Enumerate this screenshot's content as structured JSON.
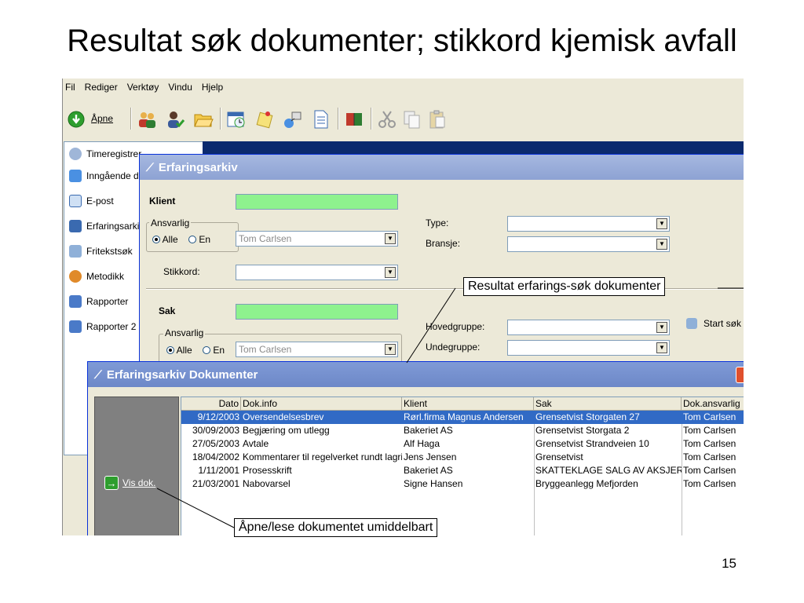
{
  "slide": {
    "title": "Resultat søk dokumenter; stikkord kjemisk avfall",
    "page_number": "15"
  },
  "menu": [
    "Fil",
    "Rediger",
    "Verktøy",
    "Vindu",
    "Hjelp"
  ],
  "toolbar": {
    "open_label": "Åpne"
  },
  "sidebar": {
    "items": [
      {
        "label": "Timeregistrer",
        "icon": "clock-icon"
      },
      {
        "label": "Inngående d",
        "icon": "inbox-icon"
      },
      {
        "label": "E-post",
        "icon": "email-icon"
      },
      {
        "label": "Erfaringsarki",
        "icon": "archive-icon"
      },
      {
        "label": "Fritekstsøk",
        "icon": "search-icon"
      },
      {
        "label": "Metodikk",
        "icon": "method-icon"
      },
      {
        "label": "Rapporter",
        "icon": "report-icon"
      },
      {
        "label": "Rapporter 2",
        "icon": "report-icon"
      }
    ]
  },
  "search_window": {
    "title": "Erfaringsarkiv",
    "klient": {
      "heading": "Klient",
      "ansvarlig_label": "Ansvarlig",
      "radio_all": "Alle",
      "radio_one": "En",
      "ansvarlig_value": "Tom Carlsen",
      "stikkord_label": "Stikkord:",
      "type_label": "Type:",
      "bransje_label": "Bransje:"
    },
    "sak": {
      "heading": "Sak",
      "ansvarlig_label": "Ansvarlig",
      "radio_all": "Alle",
      "radio_one": "En",
      "ansvarlig_value": "Tom Carlsen",
      "hovedgruppe_label": "Hovedgruppe:",
      "undegruppe_label": "Undegruppe:",
      "start_label": "Start søk"
    }
  },
  "docs_window": {
    "title": "Erfaringsarkiv Dokumenter",
    "vis_dok_label": "Vis dok.",
    "columns": [
      "Dato",
      "Dok.info",
      "Klient",
      "Sak",
      "Dok.ansvarlig"
    ],
    "rows": [
      {
        "dato": "9/12/2003",
        "info": "Oversendelsesbrev",
        "klient": "Rørl.firma Magnus Andersen",
        "sak": "Grensetvist Storgaten 27",
        "ansvarlig": "Tom Carlsen"
      },
      {
        "dato": "30/09/2003",
        "info": "Begjæring om utlegg",
        "klient": "Bakeriet AS",
        "sak": "Grensetvist Storgata 2",
        "ansvarlig": "Tom Carlsen"
      },
      {
        "dato": "27/05/2003",
        "info": "Avtale",
        "klient": "Alf Haga",
        "sak": "Grensetvist Strandveien 10",
        "ansvarlig": "Tom Carlsen"
      },
      {
        "dato": "18/04/2002",
        "info": "Kommentarer til regelverket rundt lagring",
        "klient": "Jens Jensen",
        "sak": "Grensetvist",
        "ansvarlig": "Tom Carlsen"
      },
      {
        "dato": "1/11/2001",
        "info": "Prosesskrift",
        "klient": "Bakeriet AS",
        "sak": "SKATTEKLAGE SALG AV AKSJER",
        "ansvarlig": "Tom Carlsen"
      },
      {
        "dato": "21/03/2001",
        "info": "Nabovarsel",
        "klient": "Signe Hansen",
        "sak": "Bryggeanlegg Mefjorden",
        "ansvarlig": "Tom Carlsen"
      }
    ]
  },
  "callouts": {
    "result": "Resultat erfarings-søk dokumenter",
    "open": "Åpne/lese dokumentet umiddelbart"
  },
  "colors": {
    "selection": "#316ac5",
    "green_field": "#8ef28e",
    "title_bar": "#8da2d3"
  }
}
